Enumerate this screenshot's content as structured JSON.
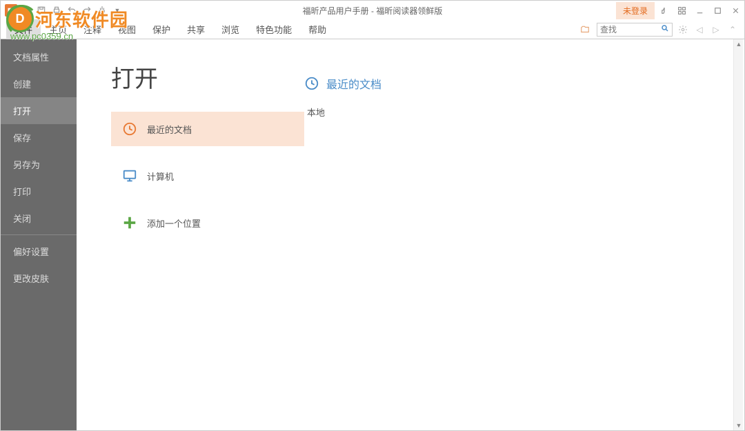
{
  "titlebar": {
    "title": "福昕产品用户手册 - 福昕阅读器领鲜版",
    "login": "未登录"
  },
  "ribbon": {
    "tabs": [
      "文件",
      "主页",
      "注释",
      "视图",
      "保护",
      "共享",
      "浏览",
      "特色功能",
      "帮助"
    ],
    "search_placeholder": "查找"
  },
  "sidebar": {
    "items": [
      {
        "label": "文档属性",
        "active": false
      },
      {
        "label": "创建",
        "active": false
      },
      {
        "label": "打开",
        "active": true
      },
      {
        "label": "保存",
        "active": false
      },
      {
        "label": "另存为",
        "active": false
      },
      {
        "label": "打印",
        "active": false
      },
      {
        "label": "关闭",
        "active": false
      }
    ],
    "items2": [
      {
        "label": "偏好设置"
      },
      {
        "label": "更改皮肤"
      }
    ]
  },
  "page": {
    "title": "打开",
    "locations": [
      {
        "label": "最近的文档",
        "icon": "clock",
        "active": true
      },
      {
        "label": "计算机",
        "icon": "computer",
        "active": false
      },
      {
        "label": "添加一个位置",
        "icon": "plus",
        "active": false
      }
    ],
    "section": {
      "heading": "最近的文档",
      "group_label": "本地"
    }
  },
  "watermark": {
    "brand": "河东软件园",
    "url": "www.pc0359.cn"
  },
  "icons": {
    "clock": "clock-icon",
    "computer": "computer-icon",
    "plus": "plus-icon"
  },
  "colors": {
    "accent": "#e87933",
    "accent_light": "#fbe3d4",
    "sidebar_bg": "#6a6a6a",
    "sidebar_active": "#858585",
    "link_blue": "#4a8cc8",
    "plus_green": "#5aa644"
  }
}
